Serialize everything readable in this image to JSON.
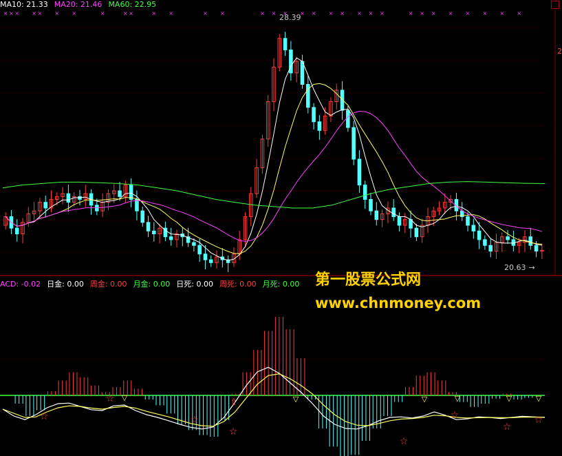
{
  "colors": {
    "background": "#000000",
    "up_candle": "#ff3b3b",
    "down_candle": "#54ffff",
    "ma5": "#ffffff",
    "ma10": "#ffff60",
    "ma20": "#ff40ff",
    "ma60": "#40ff40",
    "grid": "#8b0000",
    "xmark": "#ff40ff"
  },
  "price_panel": {
    "legend": [
      {
        "label": "MA10:",
        "value": "21.33",
        "color": "#ffffff"
      },
      {
        "label": "MA20:",
        "value": "21.46",
        "color": "#ff40ff"
      },
      {
        "label": "MA60:",
        "value": "22.95",
        "color": "#40ff40"
      }
    ],
    "high_label": "28.39",
    "low_label": "20.63",
    "right_axis_labels": [
      "2"
    ]
  },
  "macd_panel": {
    "legend": [
      {
        "label": "ACD:",
        "value": "-0.02",
        "color": "#ff40ff"
      },
      {
        "label": "日金:",
        "value": "0.00",
        "color": "#ffffff"
      },
      {
        "label": "周金:",
        "value": "0.00",
        "color": "#ff4040"
      },
      {
        "label": "月金:",
        "value": "0.00",
        "color": "#40ff40"
      },
      {
        "label": "日死:",
        "value": "0.00",
        "color": "#ffffff"
      },
      {
        "label": "周死:",
        "value": "0.00",
        "color": "#ff4040"
      },
      {
        "label": "月死:",
        "value": "0.00",
        "color": "#40ff40"
      }
    ]
  },
  "watermark": {
    "line1": "第一股票公式网",
    "line2": "www.chnmoney.com"
  },
  "chart_data": {
    "type": "candlestick",
    "close": [
      21.8,
      21.4,
      21.2,
      21.6,
      21.9,
      22.0,
      22.3,
      22.1,
      22.4,
      22.5,
      22.6,
      22.3,
      22.5,
      22.4,
      22.6,
      22.2,
      22.0,
      22.3,
      22.6,
      22.7,
      22.5,
      22.9,
      22.4,
      22.0,
      21.6,
      21.3,
      21.2,
      21.4,
      21.1,
      21.0,
      21.2,
      21.1,
      20.9,
      20.8,
      20.5,
      20.3,
      20.2,
      20.4,
      20.3,
      20.2,
      20.5,
      21.0,
      21.8,
      22.6,
      23.5,
      24.5,
      25.8,
      27.0,
      28.0,
      27.6,
      26.8,
      27.2,
      26.4,
      25.6,
      25.1,
      24.8,
      25.3,
      25.8,
      26.2,
      25.5,
      24.9,
      23.8,
      22.9,
      22.4,
      22.0,
      21.7,
      21.9,
      22.1,
      21.8,
      21.5,
      21.7,
      21.4,
      21.1,
      21.5,
      21.8,
      22.0,
      22.1,
      22.3,
      22.4,
      22.0,
      21.8,
      21.5,
      21.3,
      21.0,
      20.8,
      20.6,
      20.9,
      21.1,
      21.0,
      20.8,
      20.9,
      21.1,
      20.8,
      20.6,
      20.63
    ],
    "ma60": [
      22.8,
      22.9,
      22.95,
      23.0,
      23.0,
      22.98,
      22.95,
      22.9,
      22.8,
      22.7,
      22.55,
      22.4,
      22.3,
      22.2,
      22.15,
      22.1,
      22.1,
      22.2,
      22.4,
      22.6,
      22.75,
      22.85,
      22.95,
      23.0,
      23.02,
      23.0,
      22.98,
      22.96,
      22.95
    ],
    "macd_hist": [
      0,
      -0.1,
      -0.25,
      -0.18,
      0.05,
      0.18,
      0.28,
      0.22,
      0.12,
      0.04,
      0.1,
      0.18,
      0.08,
      -0.05,
      -0.12,
      -0.22,
      -0.35,
      -0.42,
      -0.48,
      -0.5,
      -0.3,
      0.02,
      0.28,
      0.55,
      0.78,
      0.95,
      0.8,
      0.45,
      -0.05,
      -0.4,
      -0.62,
      -0.8,
      -0.72,
      -0.55,
      -0.4,
      -0.25,
      -0.08,
      0.1,
      0.24,
      0.28,
      0.18,
      0.04,
      -0.08,
      -0.14,
      -0.1,
      -0.04,
      0.02,
      -0.05,
      -0.03,
      0.0
    ],
    "macd_dif": [
      0.0,
      -0.25,
      -0.38,
      -0.2,
      0.05,
      0.2,
      0.22,
      0.1,
      -0.02,
      -0.05,
      0.12,
      0.15,
      -0.05,
      -0.2,
      -0.3,
      -0.42,
      -0.55,
      -0.66,
      -0.72,
      -0.65,
      -0.3,
      0.25,
      0.85,
      1.35,
      1.52,
      1.3,
      0.95,
      0.6,
      0.2,
      -0.25,
      -0.55,
      -0.7,
      -0.72,
      -0.6,
      -0.42,
      -0.3,
      -0.28,
      -0.32,
      -0.25,
      -0.1,
      -0.22,
      -0.38,
      -0.35,
      -0.28,
      -0.3,
      -0.34,
      -0.3,
      -0.26,
      -0.28,
      -0.3
    ],
    "macd_dea": [
      0.0,
      -0.15,
      -0.3,
      -0.28,
      -0.1,
      0.05,
      0.12,
      0.1,
      0.04,
      0.0,
      0.06,
      0.1,
      0.04,
      -0.08,
      -0.18,
      -0.28,
      -0.4,
      -0.52,
      -0.6,
      -0.62,
      -0.45,
      -0.1,
      0.4,
      0.9,
      1.22,
      1.28,
      1.1,
      0.85,
      0.55,
      0.15,
      -0.2,
      -0.45,
      -0.58,
      -0.6,
      -0.52,
      -0.42,
      -0.36,
      -0.34,
      -0.3,
      -0.22,
      -0.24,
      -0.3,
      -0.32,
      -0.31,
      -0.3,
      -0.31,
      -0.31,
      -0.29,
      -0.29,
      -0.29
    ]
  }
}
